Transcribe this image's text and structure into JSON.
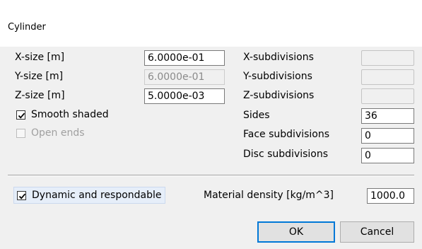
{
  "window": {
    "title": "Cylinder"
  },
  "size": {
    "x_label": "X-size [m]",
    "x_value": "6.0000e-01",
    "y_label": "Y-size [m]",
    "y_value": "6.0000e-01",
    "z_label": "Z-size [m]",
    "z_value": "5.0000e-03"
  },
  "options": {
    "smooth_shaded": "Smooth shaded",
    "open_ends": "Open ends"
  },
  "subdivisions": {
    "x_label": "X-subdivisions",
    "x_value": "",
    "y_label": "Y-subdivisions",
    "y_value": "",
    "z_label": "Z-subdivisions",
    "z_value": "",
    "sides_label": "Sides",
    "sides_value": "36",
    "face_label": "Face subdivisions",
    "face_value": "0",
    "disc_label": "Disc subdivisions",
    "disc_value": "0"
  },
  "dynamics": {
    "dynamic_label": "Dynamic and respondable",
    "density_label": "Material density [kg/m^3]",
    "density_value": "1000.0"
  },
  "buttons": {
    "ok": "OK",
    "cancel": "Cancel"
  }
}
